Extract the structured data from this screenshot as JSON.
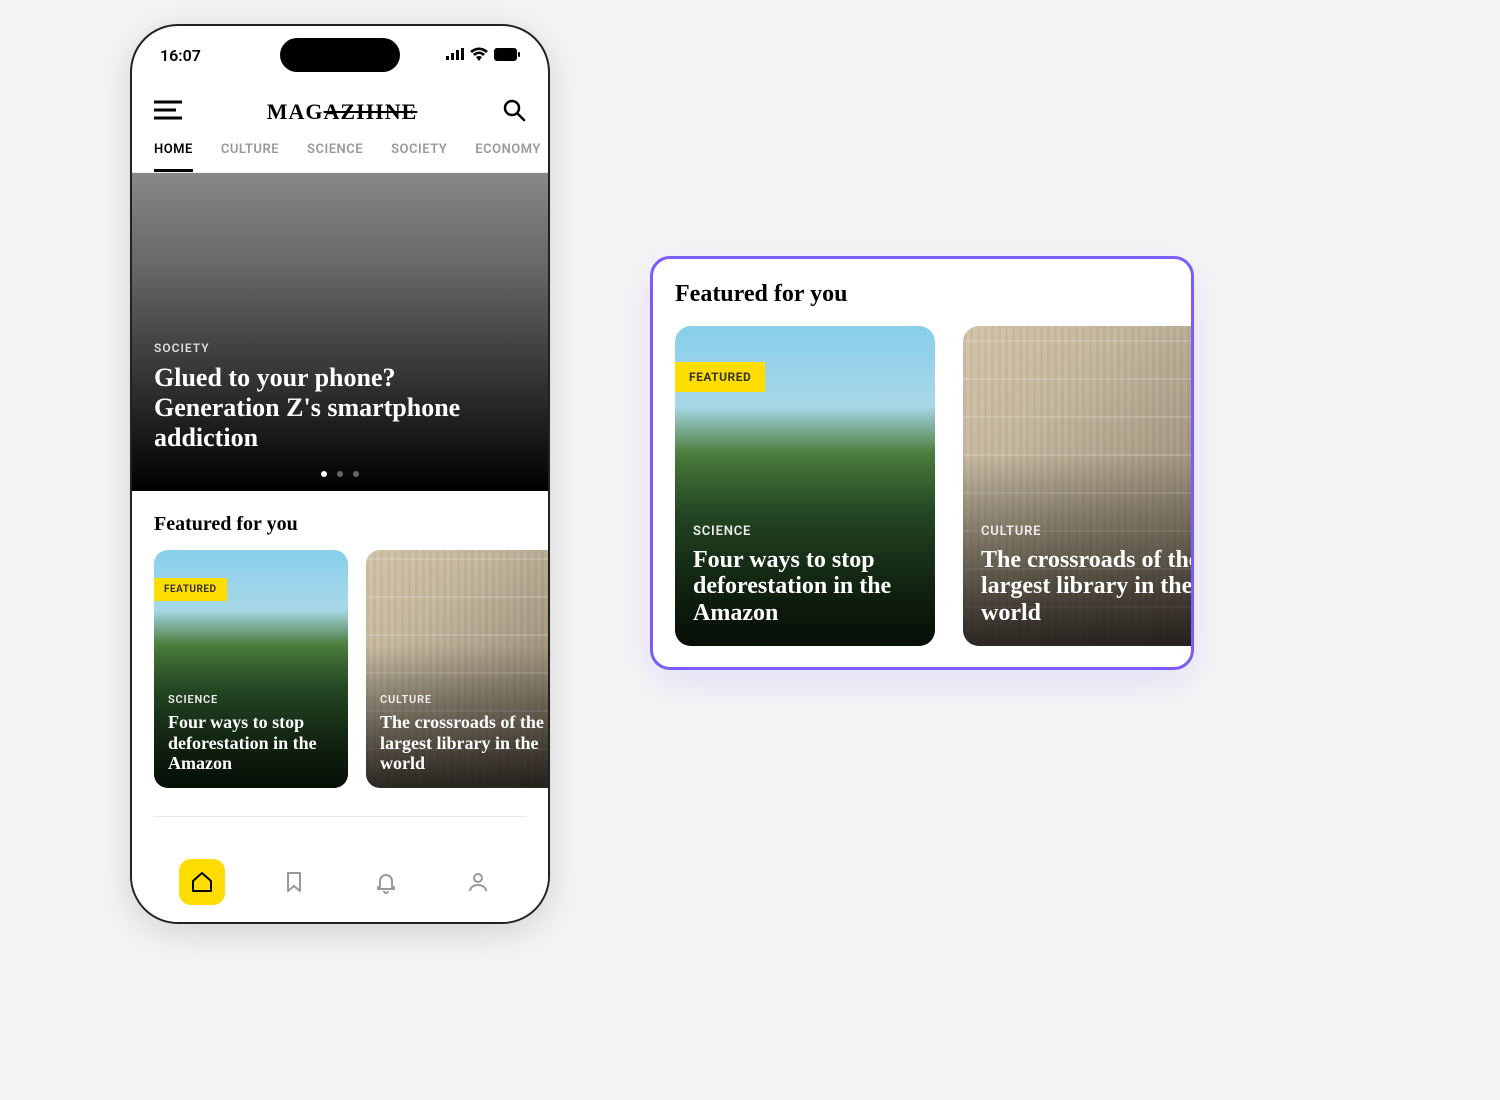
{
  "statusBar": {
    "time": "16:07"
  },
  "header": {
    "logo": "MAGAZIIINE"
  },
  "tabs": [
    "HOME",
    "CULTURE",
    "SCIENCE",
    "SOCIETY",
    "ECONOMY"
  ],
  "hero": {
    "category": "SOCIETY",
    "title": "Glued to your phone? Generation Z's smartphone addiction"
  },
  "featuredSection": {
    "title": "Featured for you",
    "cards": [
      {
        "badge": "FEATURED",
        "category": "SCIENCE",
        "title": "Four ways to stop deforestation in the Amazon"
      },
      {
        "category": "CULTURE",
        "title": "The crossroads of the largest library in the world"
      }
    ]
  },
  "panel": {
    "title": "Featured for you",
    "cards": [
      {
        "badge": "FEATURED",
        "category": "SCIENCE",
        "title": "Four ways to stop deforestation in the Amazon"
      },
      {
        "category": "CULTURE",
        "title": "The crossroads of the largest library in the world"
      }
    ]
  }
}
